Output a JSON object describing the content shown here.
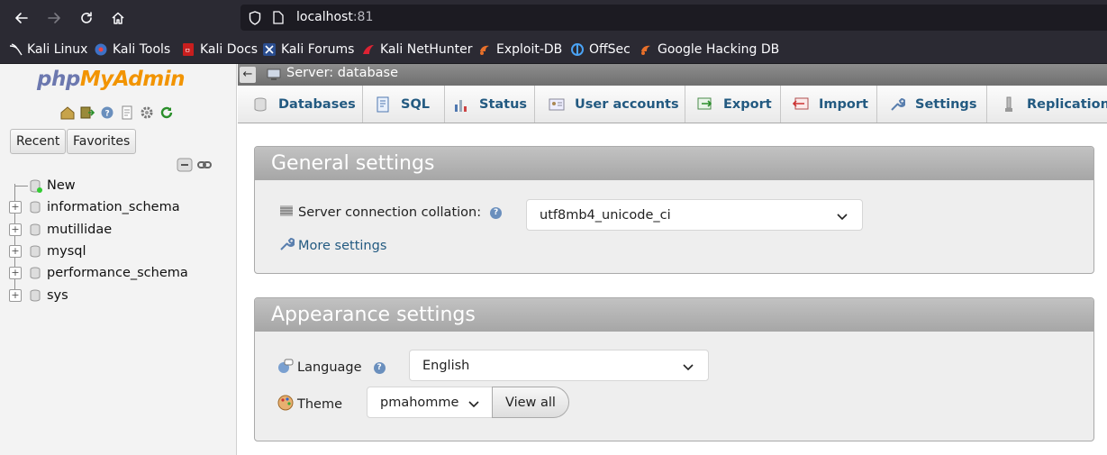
{
  "browser": {
    "url_host": "localhost",
    "url_port": ":81",
    "bookmarks": [
      {
        "label": "Kali Linux",
        "icon": "kali-dragon-icon"
      },
      {
        "label": "Kali Tools",
        "icon": "kali-tools-icon"
      },
      {
        "label": "Kali Docs",
        "icon": "kali-docs-icon"
      },
      {
        "label": "Kali Forums",
        "icon": "kali-forums-icon"
      },
      {
        "label": "Kali NetHunter",
        "icon": "kali-nethunter-icon"
      },
      {
        "label": "Exploit-DB",
        "icon": "exploit-db-icon"
      },
      {
        "label": "OffSec",
        "icon": "offsec-icon"
      },
      {
        "label": "Google Hacking DB",
        "icon": "ghdb-icon"
      }
    ]
  },
  "sidebar": {
    "logo": {
      "php": "php",
      "my": "My",
      "admin": "Admin"
    },
    "tabs": {
      "recent": "Recent",
      "favorites": "Favorites"
    },
    "tree": [
      {
        "label": "New"
      },
      {
        "label": "information_schema"
      },
      {
        "label": "mutillidae"
      },
      {
        "label": "mysql"
      },
      {
        "label": "performance_schema"
      },
      {
        "label": "sys"
      }
    ]
  },
  "breadcrumb": {
    "label": "Server: database"
  },
  "menu": [
    {
      "label": "Databases",
      "icon": "databases-icon"
    },
    {
      "label": "SQL",
      "icon": "sql-icon"
    },
    {
      "label": "Status",
      "icon": "status-icon"
    },
    {
      "label": "User accounts",
      "icon": "user-accounts-icon"
    },
    {
      "label": "Export",
      "icon": "export-icon"
    },
    {
      "label": "Import",
      "icon": "import-icon"
    },
    {
      "label": "Settings",
      "icon": "wrench-icon"
    },
    {
      "label": "Replication",
      "icon": "replication-icon"
    }
  ],
  "general": {
    "title": "General settings",
    "collation_label": "Server connection collation:",
    "collation_value": "utf8mb4_unicode_ci",
    "more_settings": "More settings"
  },
  "appearance": {
    "title": "Appearance settings",
    "language_label": "Language",
    "language_value": "English",
    "theme_label": "Theme",
    "theme_value": "pmahomme",
    "view_all": "View all"
  },
  "colors": {
    "chrome": "#2b2a33",
    "link": "#235a81",
    "panel_header": "#a6a6a6"
  }
}
